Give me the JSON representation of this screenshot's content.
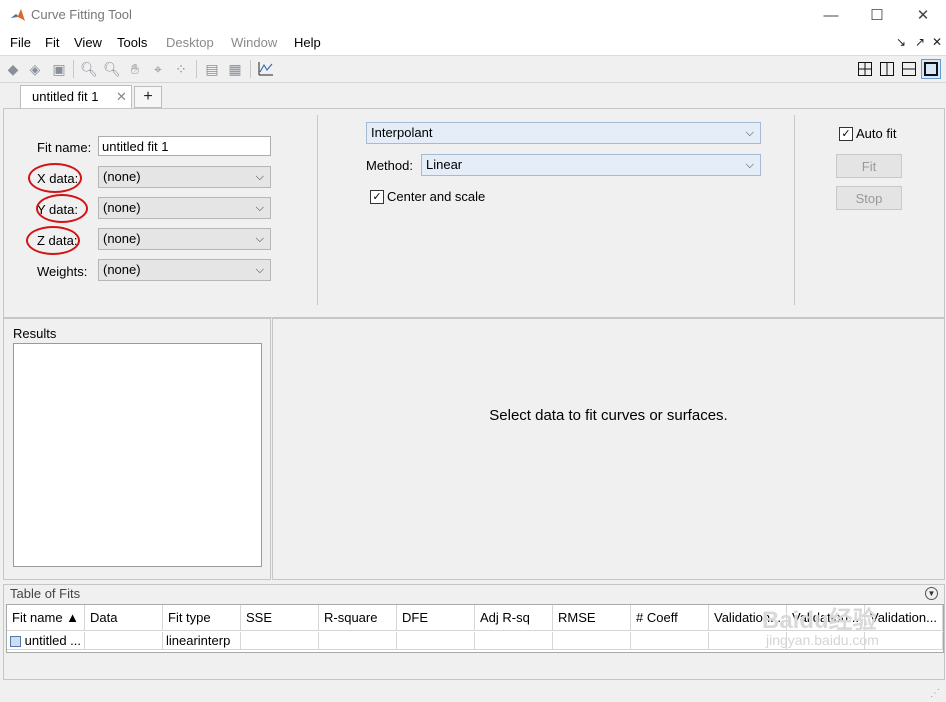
{
  "window": {
    "title": "Curve Fitting Tool",
    "minimize": "—",
    "maximize": "☐",
    "close": "✕"
  },
  "menu": {
    "items": [
      "File",
      "Fit",
      "View",
      "Tools",
      "Desktop",
      "Window",
      "Help"
    ]
  },
  "tabs": {
    "active": "untitled fit 1",
    "add": "+"
  },
  "fit": {
    "name_label": "Fit name:",
    "name_value": "untitled fit 1",
    "x_label": "X data:",
    "y_label": "Y data:",
    "z_label": "Z data:",
    "weights_label": "Weights:",
    "x_value": "(none)",
    "y_value": "(none)",
    "z_value": "(none)",
    "weights_value": "(none)",
    "type_value": "Interpolant",
    "method_label": "Method:",
    "method_value": "Linear",
    "center_scale_label": "Center and scale",
    "center_scale_checked": true,
    "auto_fit_label": "Auto fit",
    "auto_fit_checked": true,
    "fit_button": "Fit",
    "stop_button": "Stop"
  },
  "results": {
    "title": "Results"
  },
  "plot": {
    "message": "Select data to fit curves or surfaces."
  },
  "table_of_fits": {
    "title": "Table of Fits",
    "columns": [
      "Fit name ▲",
      "Data",
      "Fit type",
      "SSE",
      "R-square",
      "DFE",
      "Adj R-sq",
      "RMSE",
      "# Coeff",
      "Validation...",
      "Validation...",
      "Validation..."
    ],
    "rows": [
      [
        "untitled ...",
        "",
        "linearinterp",
        "",
        "",
        "",
        "",
        "",
        "",
        "",
        "",
        ""
      ]
    ]
  },
  "watermark": {
    "brand": "Baidu经验",
    "url": "jingyan.baidu.com"
  },
  "colors": {
    "annotation": "#d21414",
    "blue_combo": "#e4edf8"
  }
}
